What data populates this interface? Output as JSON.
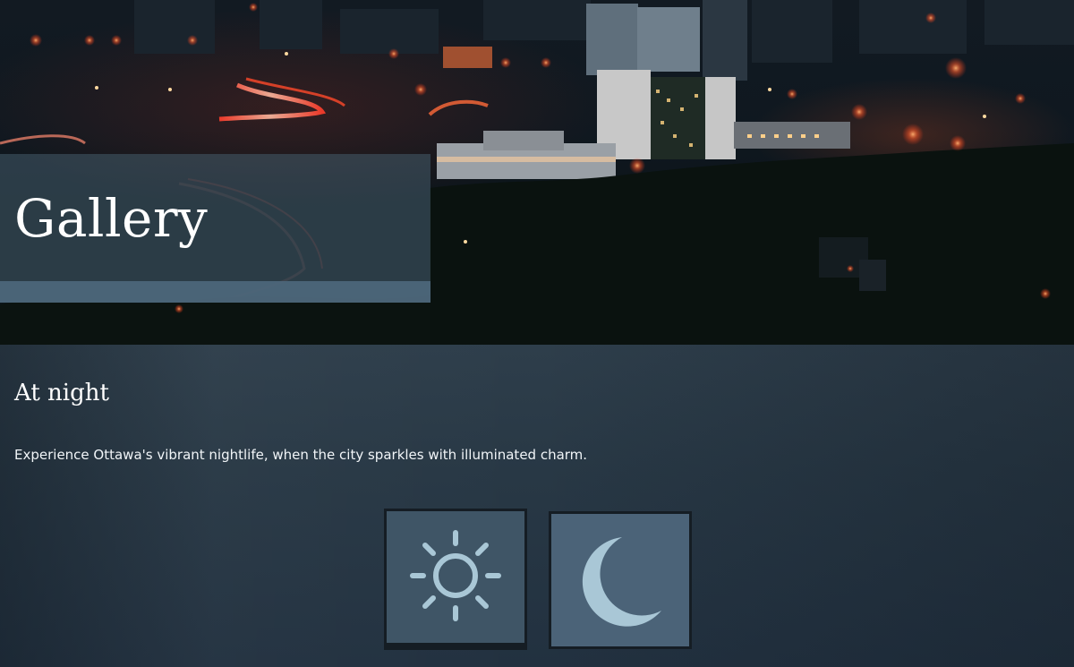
{
  "hero": {
    "title": "Gallery"
  },
  "section": {
    "heading": "At night",
    "description": "Experience Ottawa's vibrant nightlife, when the city sparkles with illuminated charm."
  },
  "mode_toggle": {
    "day_icon": "sun-icon",
    "night_icon": "moon-icon",
    "selected": "night"
  },
  "colors": {
    "panel_bg": "#263542",
    "icon_color": "#a9c7d6",
    "button_day": "#3f5566",
    "button_night": "#4b6378"
  }
}
